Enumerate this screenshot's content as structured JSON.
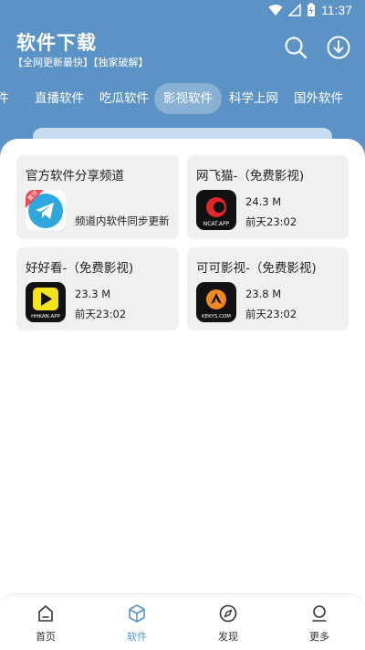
{
  "status_bar": {
    "time": "11:37"
  },
  "header": {
    "title": "软件下载",
    "subtitle": "【全网更新最快】【独家破解】"
  },
  "tabs": [
    {
      "label": "件"
    },
    {
      "label": "直播软件"
    },
    {
      "label": "吃瓜软件"
    },
    {
      "label": "影视软件"
    },
    {
      "label": "科学上网"
    },
    {
      "label": "国外软件"
    }
  ],
  "active_tab": "影视软件",
  "cards": [
    {
      "title": "官方软件分享频道",
      "badge": "置顶",
      "description": "频道内软件同步更新"
    },
    {
      "title": "网飞猫-（免费影视)",
      "size": "24.3 M",
      "date": "前天23:02",
      "icon_text": "NCAT.APP"
    },
    {
      "title": "好好看-（免费影视)",
      "size": "23.3 M",
      "date": "前天23:02",
      "icon_text": "HHKAN.APP"
    },
    {
      "title": "可可影视-（免费影视)",
      "size": "23.8 M",
      "date": "前天23:02",
      "icon_text": "KEKYS.COM"
    }
  ],
  "bottom_nav": [
    {
      "label": "首页",
      "icon": "home-icon"
    },
    {
      "label": "软件",
      "icon": "cube-icon"
    },
    {
      "label": "发现",
      "icon": "compass-icon"
    },
    {
      "label": "更多",
      "icon": "user-icon"
    }
  ],
  "colors": {
    "primary": "#5c93c6",
    "card_bg": "#f0f0f0",
    "active_nav": "#5c93c6"
  }
}
